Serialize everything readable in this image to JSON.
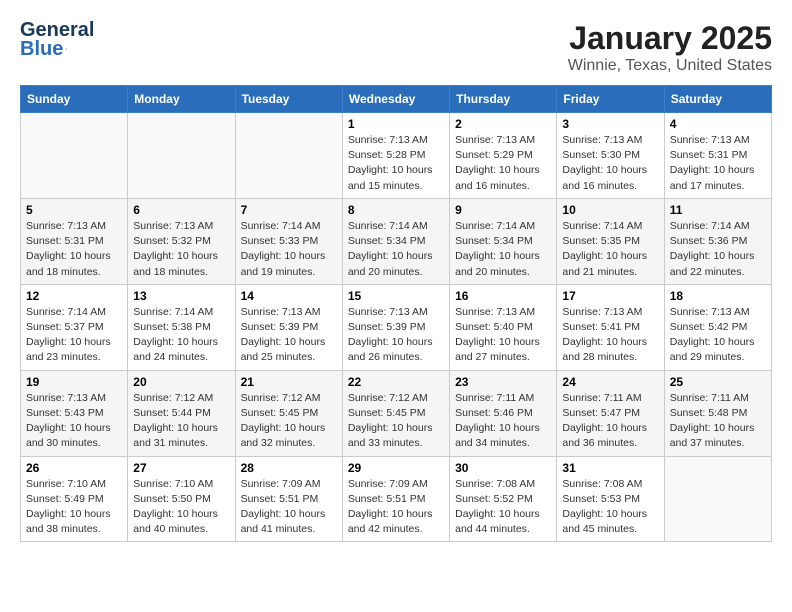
{
  "header": {
    "logo_general": "General",
    "logo_blue": "Blue",
    "title": "January 2025",
    "subtitle": "Winnie, Texas, United States"
  },
  "calendar": {
    "days_of_week": [
      "Sunday",
      "Monday",
      "Tuesday",
      "Wednesday",
      "Thursday",
      "Friday",
      "Saturday"
    ],
    "weeks": [
      [
        {
          "day": "",
          "info": ""
        },
        {
          "day": "",
          "info": ""
        },
        {
          "day": "",
          "info": ""
        },
        {
          "day": "1",
          "info": "Sunrise: 7:13 AM\nSunset: 5:28 PM\nDaylight: 10 hours\nand 15 minutes."
        },
        {
          "day": "2",
          "info": "Sunrise: 7:13 AM\nSunset: 5:29 PM\nDaylight: 10 hours\nand 16 minutes."
        },
        {
          "day": "3",
          "info": "Sunrise: 7:13 AM\nSunset: 5:30 PM\nDaylight: 10 hours\nand 16 minutes."
        },
        {
          "day": "4",
          "info": "Sunrise: 7:13 AM\nSunset: 5:31 PM\nDaylight: 10 hours\nand 17 minutes."
        }
      ],
      [
        {
          "day": "5",
          "info": "Sunrise: 7:13 AM\nSunset: 5:31 PM\nDaylight: 10 hours\nand 18 minutes."
        },
        {
          "day": "6",
          "info": "Sunrise: 7:13 AM\nSunset: 5:32 PM\nDaylight: 10 hours\nand 18 minutes."
        },
        {
          "day": "7",
          "info": "Sunrise: 7:14 AM\nSunset: 5:33 PM\nDaylight: 10 hours\nand 19 minutes."
        },
        {
          "day": "8",
          "info": "Sunrise: 7:14 AM\nSunset: 5:34 PM\nDaylight: 10 hours\nand 20 minutes."
        },
        {
          "day": "9",
          "info": "Sunrise: 7:14 AM\nSunset: 5:34 PM\nDaylight: 10 hours\nand 20 minutes."
        },
        {
          "day": "10",
          "info": "Sunrise: 7:14 AM\nSunset: 5:35 PM\nDaylight: 10 hours\nand 21 minutes."
        },
        {
          "day": "11",
          "info": "Sunrise: 7:14 AM\nSunset: 5:36 PM\nDaylight: 10 hours\nand 22 minutes."
        }
      ],
      [
        {
          "day": "12",
          "info": "Sunrise: 7:14 AM\nSunset: 5:37 PM\nDaylight: 10 hours\nand 23 minutes."
        },
        {
          "day": "13",
          "info": "Sunrise: 7:14 AM\nSunset: 5:38 PM\nDaylight: 10 hours\nand 24 minutes."
        },
        {
          "day": "14",
          "info": "Sunrise: 7:13 AM\nSunset: 5:39 PM\nDaylight: 10 hours\nand 25 minutes."
        },
        {
          "day": "15",
          "info": "Sunrise: 7:13 AM\nSunset: 5:39 PM\nDaylight: 10 hours\nand 26 minutes."
        },
        {
          "day": "16",
          "info": "Sunrise: 7:13 AM\nSunset: 5:40 PM\nDaylight: 10 hours\nand 27 minutes."
        },
        {
          "day": "17",
          "info": "Sunrise: 7:13 AM\nSunset: 5:41 PM\nDaylight: 10 hours\nand 28 minutes."
        },
        {
          "day": "18",
          "info": "Sunrise: 7:13 AM\nSunset: 5:42 PM\nDaylight: 10 hours\nand 29 minutes."
        }
      ],
      [
        {
          "day": "19",
          "info": "Sunrise: 7:13 AM\nSunset: 5:43 PM\nDaylight: 10 hours\nand 30 minutes."
        },
        {
          "day": "20",
          "info": "Sunrise: 7:12 AM\nSunset: 5:44 PM\nDaylight: 10 hours\nand 31 minutes."
        },
        {
          "day": "21",
          "info": "Sunrise: 7:12 AM\nSunset: 5:45 PM\nDaylight: 10 hours\nand 32 minutes."
        },
        {
          "day": "22",
          "info": "Sunrise: 7:12 AM\nSunset: 5:45 PM\nDaylight: 10 hours\nand 33 minutes."
        },
        {
          "day": "23",
          "info": "Sunrise: 7:11 AM\nSunset: 5:46 PM\nDaylight: 10 hours\nand 34 minutes."
        },
        {
          "day": "24",
          "info": "Sunrise: 7:11 AM\nSunset: 5:47 PM\nDaylight: 10 hours\nand 36 minutes."
        },
        {
          "day": "25",
          "info": "Sunrise: 7:11 AM\nSunset: 5:48 PM\nDaylight: 10 hours\nand 37 minutes."
        }
      ],
      [
        {
          "day": "26",
          "info": "Sunrise: 7:10 AM\nSunset: 5:49 PM\nDaylight: 10 hours\nand 38 minutes."
        },
        {
          "day": "27",
          "info": "Sunrise: 7:10 AM\nSunset: 5:50 PM\nDaylight: 10 hours\nand 40 minutes."
        },
        {
          "day": "28",
          "info": "Sunrise: 7:09 AM\nSunset: 5:51 PM\nDaylight: 10 hours\nand 41 minutes."
        },
        {
          "day": "29",
          "info": "Sunrise: 7:09 AM\nSunset: 5:51 PM\nDaylight: 10 hours\nand 42 minutes."
        },
        {
          "day": "30",
          "info": "Sunrise: 7:08 AM\nSunset: 5:52 PM\nDaylight: 10 hours\nand 44 minutes."
        },
        {
          "day": "31",
          "info": "Sunrise: 7:08 AM\nSunset: 5:53 PM\nDaylight: 10 hours\nand 45 minutes."
        },
        {
          "day": "",
          "info": ""
        }
      ]
    ]
  }
}
